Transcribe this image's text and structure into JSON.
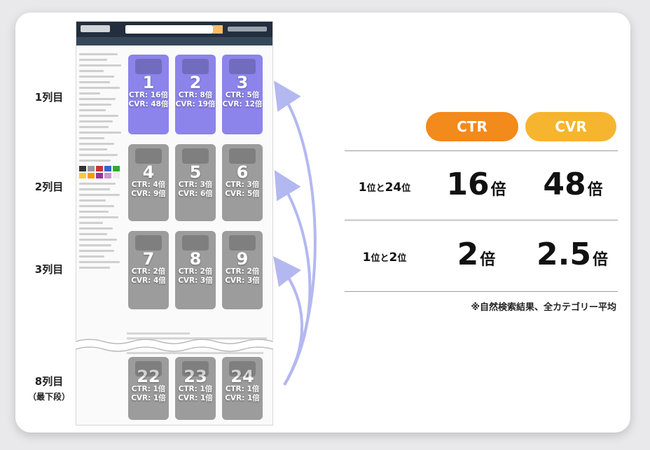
{
  "row_labels": [
    {
      "text": "1列目",
      "sub": ""
    },
    {
      "text": "2列目",
      "sub": ""
    },
    {
      "text": "3列目",
      "sub": ""
    },
    {
      "text": "8列目",
      "sub": "（最下段）"
    }
  ],
  "tiles": [
    {
      "num": "1",
      "ctr": "CTR: 16倍",
      "cvr": "CVR: 48倍",
      "style": "blue"
    },
    {
      "num": "2",
      "ctr": "CTR: 8倍",
      "cvr": "CVR: 19倍",
      "style": "blue"
    },
    {
      "num": "3",
      "ctr": "CTR: 5倍",
      "cvr": "CVR: 12倍",
      "style": "blue"
    },
    {
      "num": "4",
      "ctr": "CTR: 4倍",
      "cvr": "CVR: 9倍",
      "style": "gray"
    },
    {
      "num": "5",
      "ctr": "CTR: 3倍",
      "cvr": "CVR: 6倍",
      "style": "gray"
    },
    {
      "num": "6",
      "ctr": "CTR: 3倍",
      "cvr": "CVR: 5倍",
      "style": "gray"
    },
    {
      "num": "7",
      "ctr": "CTR: 2倍",
      "cvr": "CVR: 4倍",
      "style": "gray"
    },
    {
      "num": "8",
      "ctr": "CTR: 2倍",
      "cvr": "CVR: 3倍",
      "style": "gray"
    },
    {
      "num": "9",
      "ctr": "CTR: 2倍",
      "cvr": "CVR: 3倍",
      "style": "gray"
    },
    {
      "num": "22",
      "ctr": "CTR: 1倍",
      "cvr": "CVR: 1倍",
      "style": "gray"
    },
    {
      "num": "23",
      "ctr": "CTR: 1倍",
      "cvr": "CVR: 1倍",
      "style": "gray"
    },
    {
      "num": "24",
      "ctr": "CTR: 1倍",
      "cvr": "CVR: 1倍",
      "style": "gray"
    }
  ],
  "summary": {
    "ctr_label": "CTR",
    "cvr_label": "CVR",
    "rows": [
      {
        "lead_a": "1",
        "lead_b": "位と",
        "lead_c": "24",
        "lead_d": "位",
        "ctr": "16",
        "cvr": "48",
        "unit": "倍"
      },
      {
        "lead_a": "1",
        "lead_b": "位と",
        "lead_c": "2",
        "lead_d": "位",
        "ctr": "2",
        "cvr": "2.5",
        "unit": "倍"
      }
    ],
    "note": "※自然検索結果、全カテゴリー平均"
  },
  "colors": {
    "ctr": "#f28a1c",
    "cvr": "#f6b52e",
    "highlight": "#786ee6",
    "arrow": "#b4b8f0"
  }
}
